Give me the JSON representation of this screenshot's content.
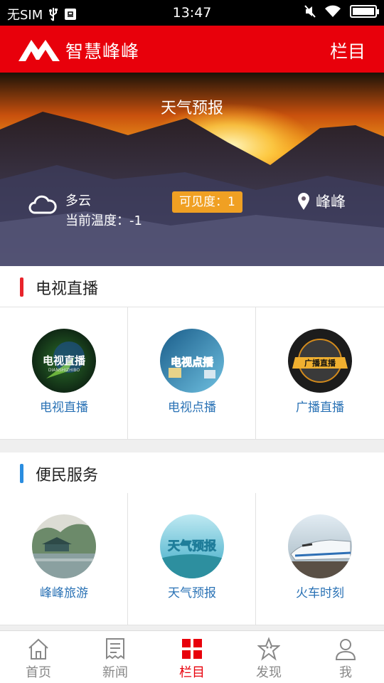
{
  "status_bar": {
    "carrier": "无SIM",
    "time": "13:47"
  },
  "app_bar": {
    "title": "智慧峰峰",
    "menu_label": "栏目"
  },
  "weather": {
    "title": "天气预报",
    "condition": "多云",
    "temperature": "当前温度：-1",
    "visibility": "可见度：1",
    "location": "峰峰"
  },
  "sections": [
    {
      "title": "电视直播",
      "accent": "#e8242b",
      "items": [
        {
          "label": "电视直播",
          "thumb_text": "电视直播",
          "thumb_sub": "DIANSHIZHIBO"
        },
        {
          "label": "电视点播",
          "thumb_text": "电视点播"
        },
        {
          "label": "广播直播",
          "thumb_text": "广播直播"
        }
      ]
    },
    {
      "title": "便民服务",
      "accent": "#2a8de0",
      "items": [
        {
          "label": "峰峰旅游"
        },
        {
          "label": "天气预报",
          "thumb_text": "天气预报"
        },
        {
          "label": "火车时刻"
        }
      ]
    }
  ],
  "tabs": [
    {
      "label": "首页",
      "icon": "home-icon"
    },
    {
      "label": "新闻",
      "icon": "news-icon"
    },
    {
      "label": "栏目",
      "icon": "grid-icon",
      "active": true
    },
    {
      "label": "发现",
      "icon": "discover-icon"
    },
    {
      "label": "我",
      "icon": "profile-icon"
    }
  ],
  "colors": {
    "brand_red": "#e8000b",
    "link_blue": "#2a72b5",
    "badge_orange": "#f0a023"
  }
}
